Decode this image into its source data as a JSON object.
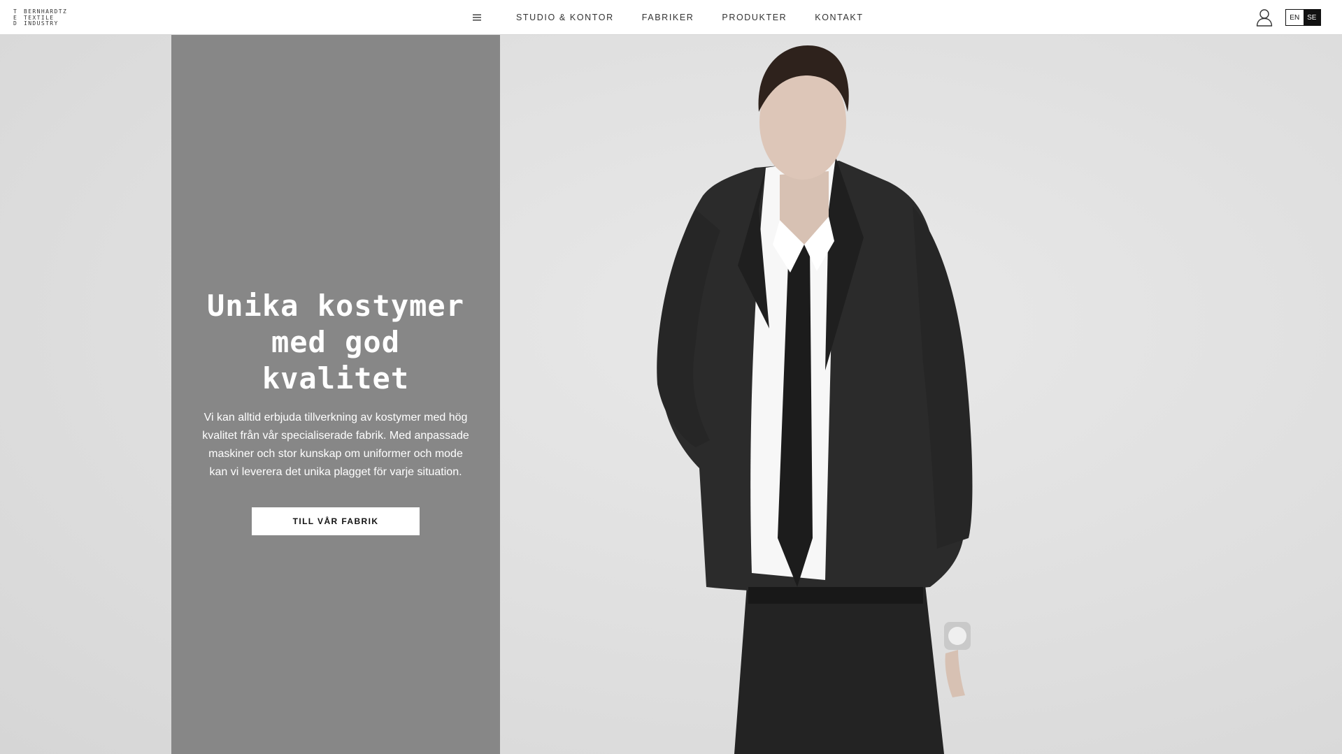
{
  "header": {
    "logo": {
      "initials": [
        "T",
        "E",
        "D"
      ],
      "words": [
        "BERNHARDTZ",
        "TEXTILE",
        "INDUSTRY"
      ]
    },
    "menu_icon": "hamburger-menu-icon",
    "nav": [
      "STUDIO & KONTOR",
      "FABRIKER",
      "PRODUKTER",
      "KONTAKT"
    ],
    "user_icon": "user-icon",
    "languages": [
      "EN",
      "SE"
    ],
    "active_language": "SE"
  },
  "hero": {
    "heading_lines": [
      "Unika kostymer",
      "med god",
      "kvalitet"
    ],
    "body_lines": [
      "Vi kan alltid erbjuda tillverkning av kostymer med hög",
      "kvalitet från vår specialiserade fabrik. Med anpassade",
      "maskiner och stor kunskap om uniformer och mode",
      "kan vi leverera det unika plagget för varje situation."
    ],
    "cta_label": "TILL VÅR FABRIK",
    "colors": {
      "panel": "#878787",
      "background": "#e2e2e2",
      "suit": "#2a2a2a",
      "shirt": "#f7f7f7"
    },
    "image": "man-in-black-suit-photo"
  }
}
